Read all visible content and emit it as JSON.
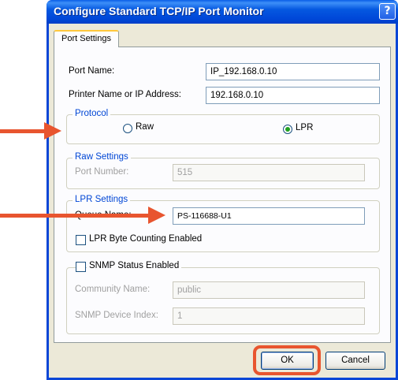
{
  "window": {
    "title": "Configure Standard TCP/IP Port Monitor",
    "help_glyph": "?",
    "close_glyph": "✕"
  },
  "tabs": [
    {
      "label": "Port Settings",
      "selected": true
    }
  ],
  "fields": {
    "port_name": {
      "label": "Port Name:",
      "value": "IP_192.168.0.10"
    },
    "printer_address": {
      "label": "Printer Name or IP Address:",
      "value": "192.168.0.10"
    }
  },
  "protocol": {
    "legend": "Protocol",
    "options": [
      {
        "label": "Raw",
        "selected": false
      },
      {
        "label": "LPR",
        "selected": true
      }
    ]
  },
  "raw_settings": {
    "legend": "Raw Settings",
    "port_number_label": "Port Number:",
    "port_number_value": "515"
  },
  "lpr_settings": {
    "legend": "LPR Settings",
    "queue_name_label": "Queue Name:",
    "queue_name_value": "PS-116688-U1",
    "byte_counting_label": "LPR Byte Counting Enabled",
    "byte_counting_checked": false
  },
  "snmp": {
    "legend": "SNMP Status Enabled",
    "enabled": false,
    "community_label": "Community Name:",
    "community_value": "public",
    "device_index_label": "SNMP Device Index:",
    "device_index_value": "1"
  },
  "buttons": {
    "ok": "OK",
    "cancel": "Cancel"
  },
  "annotations": {
    "color": "#e8552f",
    "arrow_count": 2,
    "highlight": "ok-button"
  }
}
